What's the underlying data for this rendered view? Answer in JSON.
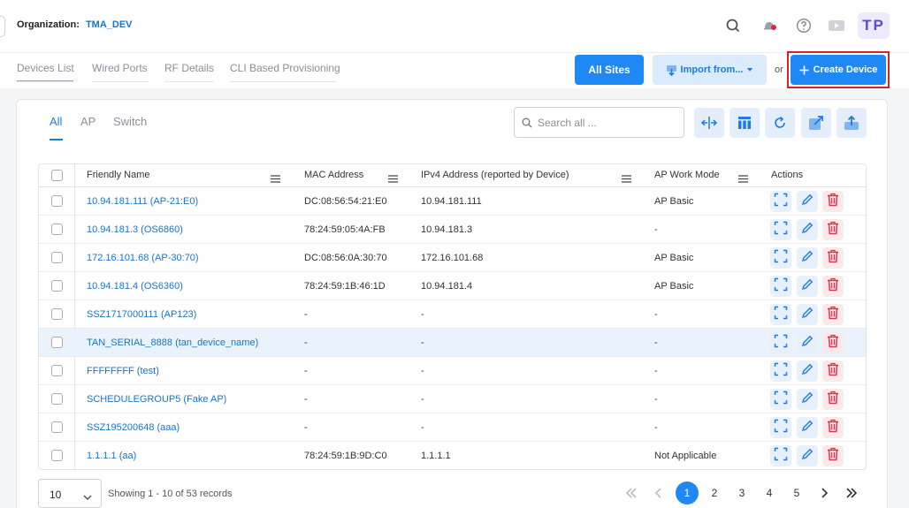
{
  "header": {
    "org_label": "Organization:",
    "org_value": "TMA_DEV",
    "avatar": "TP",
    "icons": [
      "search-icon",
      "notification-bell-icon",
      "help-icon",
      "video-icon"
    ]
  },
  "nav_tabs": [
    "Devices List",
    "Wired Ports",
    "RF Details",
    "CLI Based Provisioning"
  ],
  "toolbar": {
    "all_sites": "All Sites",
    "import": "Import from...",
    "or": "or",
    "create": "Create Device"
  },
  "filter_tabs": [
    "All",
    "AP",
    "Switch"
  ],
  "search": {
    "placeholder": "Search all ..."
  },
  "tools": [
    "column-resize-icon",
    "column-settings-icon",
    "refresh-icon",
    "export-icon",
    "upload-icon"
  ],
  "table": {
    "columns": {
      "name": "Friendly Name",
      "mac": "MAC Address",
      "ipv4": "IPv4 Address (reported by Device)",
      "mode": "AP Work Mode",
      "actions": "Actions"
    },
    "rows": [
      {
        "name": "10.94.181.111 (AP-21:E0)",
        "mac": "DC:08:56:54:21:E0",
        "ipv4": "10.94.181.111",
        "mode": "AP Basic"
      },
      {
        "name": "10.94.181.3 (OS6860)",
        "mac": "78:24:59:05:4A:FB",
        "ipv4": "10.94.181.3",
        "mode": "-"
      },
      {
        "name": "172.16.101.68 (AP-30:70)",
        "mac": "DC:08:56:0A:30:70",
        "ipv4": "172.16.101.68",
        "mode": "AP Basic"
      },
      {
        "name": "10.94.181.4 (OS6360)",
        "mac": "78:24:59:1B:46:1D",
        "ipv4": "10.94.181.4",
        "mode": "AP Basic"
      },
      {
        "name": "SSZ1717000111 (AP123)",
        "mac": "-",
        "ipv4": "-",
        "mode": "-"
      },
      {
        "name": "TAN_SERIAL_8888 (tan_device_name)",
        "mac": "-",
        "ipv4": "-",
        "mode": "-"
      },
      {
        "name": "FFFFFFFF (test)",
        "mac": "-",
        "ipv4": "-",
        "mode": "-"
      },
      {
        "name": "SCHEDULEGROUP5 (Fake AP)",
        "mac": "-",
        "ipv4": "-",
        "mode": "-"
      },
      {
        "name": "SSZ195200648 (aaa)",
        "mac": "-",
        "ipv4": "-",
        "mode": "-"
      },
      {
        "name": "1.1.1.1 (aa)",
        "mac": "78:24:59:1B:9D:C0",
        "ipv4": "1.1.1.1",
        "mode": "Not Applicable"
      }
    ]
  },
  "footer": {
    "page_size": "10",
    "showing": "Showing 1 - 10 of 53 records",
    "pages": [
      "1",
      "2",
      "3",
      "4",
      "5"
    ],
    "current_page": "1"
  },
  "colors": {
    "accent": "#1e88f5",
    "link": "#1a73c8",
    "highlight_outline": "#d8222a",
    "delete": "#e0324b"
  }
}
